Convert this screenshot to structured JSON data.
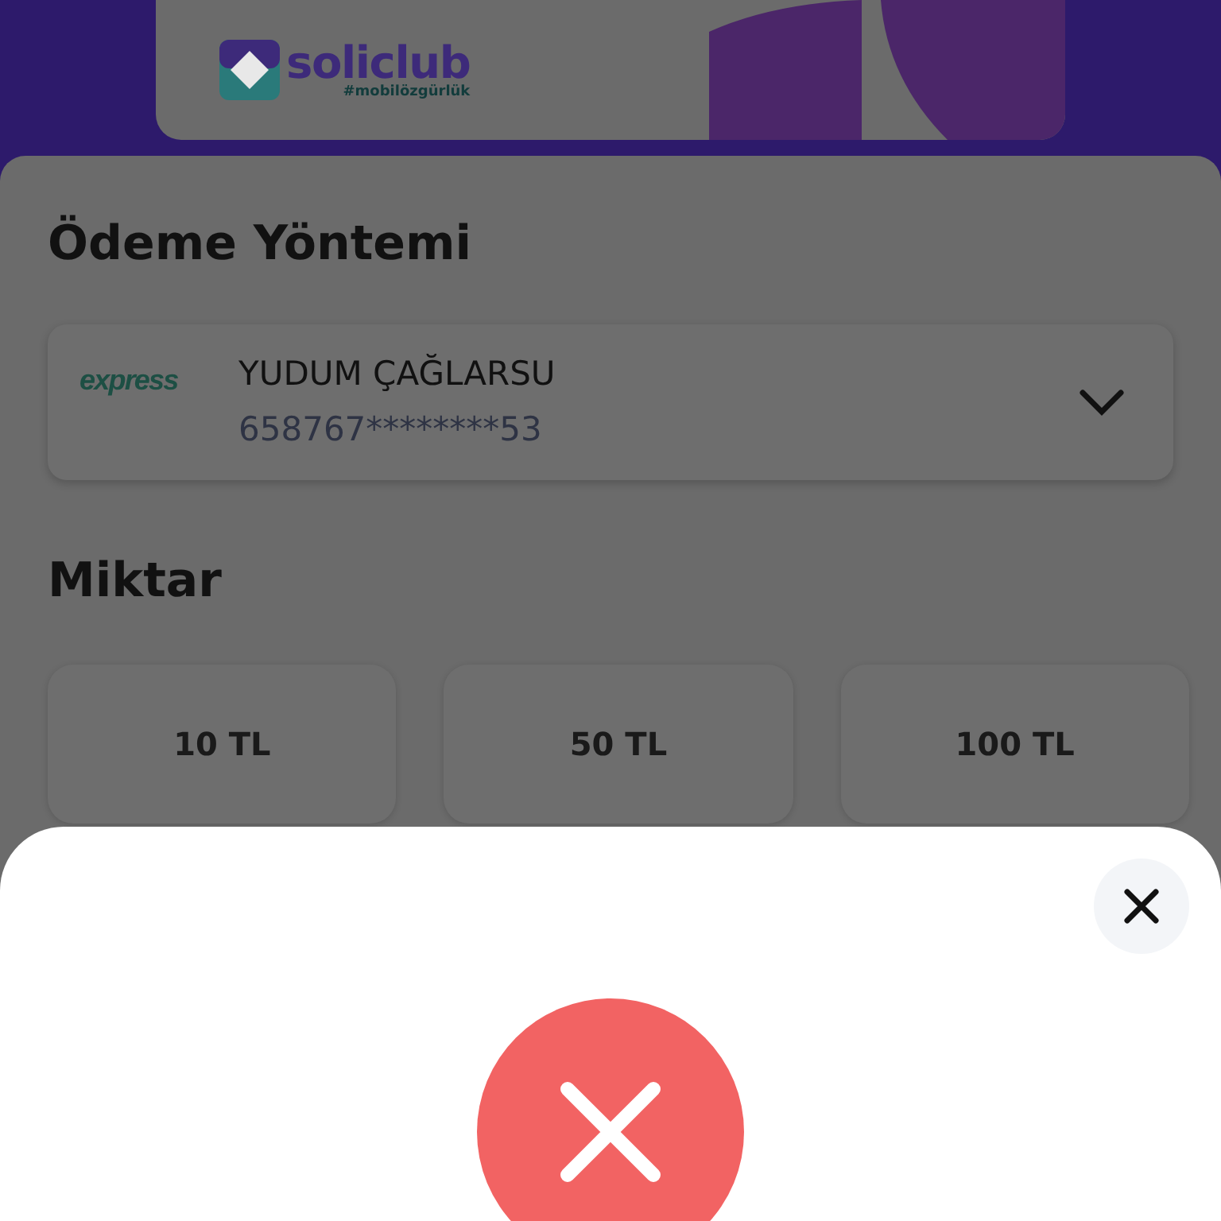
{
  "banner": {
    "brand": "soliclub",
    "tagline": "#mobilözgürlük"
  },
  "payment_method": {
    "title": "Ödeme Yöntemi",
    "card": {
      "provider": "express",
      "holder": "YUDUM ÇAĞLARSU",
      "number": "658767********53"
    }
  },
  "amount": {
    "title": "Miktar",
    "options": [
      {
        "label": "10 TL"
      },
      {
        "label": "50 TL"
      },
      {
        "label": "100 TL"
      }
    ]
  },
  "result_sheet": {
    "icon": {
      "kind": "error"
    }
  }
}
